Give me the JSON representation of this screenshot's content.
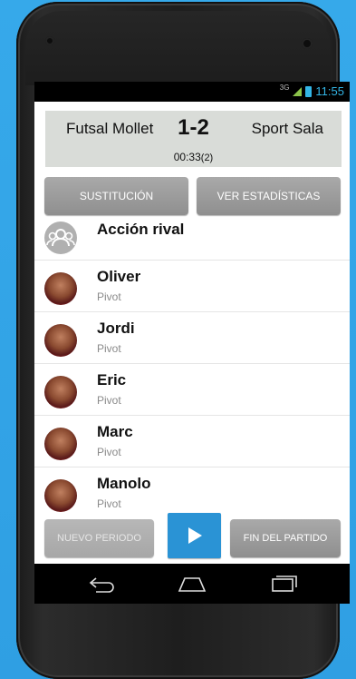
{
  "status": {
    "network": "3G",
    "time": "11:55"
  },
  "match": {
    "home_team": "Futsal Mollet",
    "score": "1-2",
    "away_team": "Sport Sala",
    "clock": "00:33",
    "period": "(2)"
  },
  "actions": {
    "substitution": "SUSTITUCIÓN",
    "stats": "VER ESTADÍSTICAS"
  },
  "rival": {
    "label": "Acción rival"
  },
  "players": [
    {
      "name": "Oliver",
      "position": "Pivot"
    },
    {
      "name": "Jordi",
      "position": "Pivot"
    },
    {
      "name": "Eric",
      "position": "Pivot"
    },
    {
      "name": "Marc",
      "position": "Pivot"
    },
    {
      "name": "Manolo",
      "position": "Pivot"
    }
  ],
  "bottom": {
    "new_period": "NUEVO PERIODO",
    "end_match": "FIN DEL PARTIDO"
  },
  "colors": {
    "accent": "#2a93d5",
    "status_blue": "#33b5e5",
    "button_gray": "#9a9a9a"
  }
}
